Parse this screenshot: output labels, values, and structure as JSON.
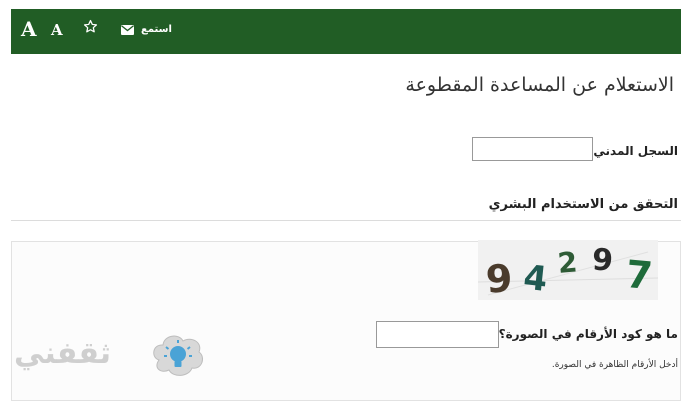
{
  "toolbar": {
    "font_increase": "A",
    "font_decrease": "A",
    "listen_label": "استمع"
  },
  "page": {
    "title": "الاستعلام عن المساعدة المقطوعة"
  },
  "form": {
    "civil_registry_label": "السجل المدني",
    "required_mark": "*",
    "civil_registry_value": "",
    "human_verification_title": "التحقق من الاستخدام البشري",
    "captcha_digits": [
      "9",
      "4",
      "2",
      "9",
      "7"
    ],
    "code_label": "ما هو كود الأرقام في الصورة؟",
    "code_value": "",
    "code_hint": "أدخل الأرقام الظاهرة في الصورة."
  },
  "logo": {
    "text": "ثقفني"
  },
  "colors": {
    "toolbar_bg": "#215d25",
    "required": "#c04800"
  },
  "icons": {
    "star": "star-icon",
    "listen": "envelope-icon",
    "logo": "lightbulb-icon"
  }
}
